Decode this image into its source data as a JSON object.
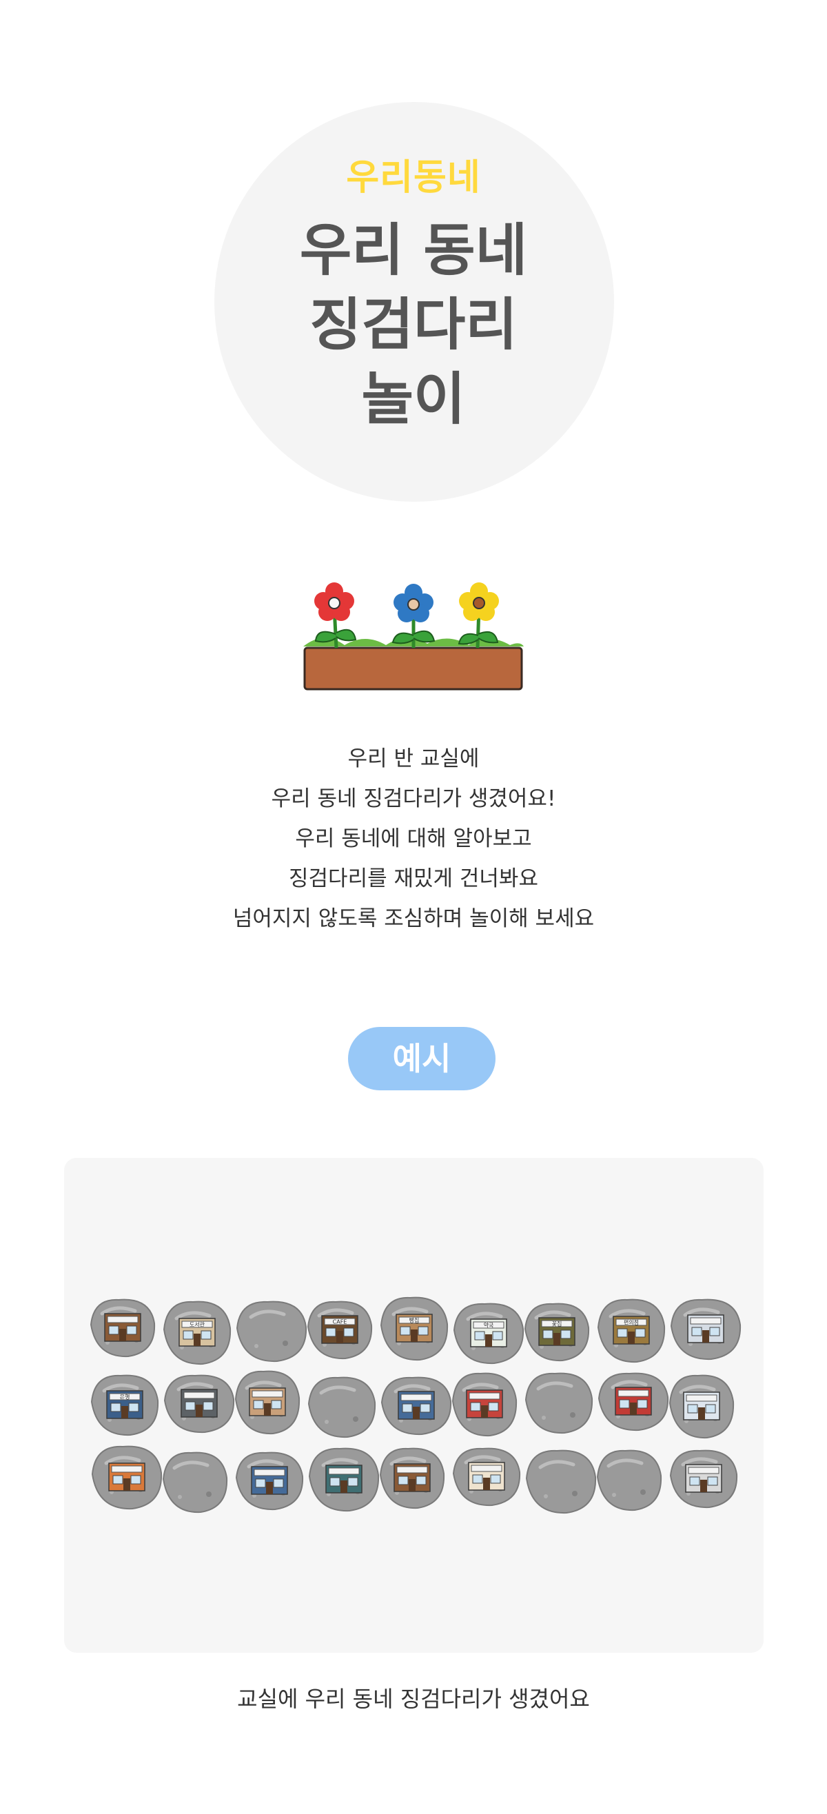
{
  "hero": {
    "tag": "우리동네",
    "title_lines": [
      "우리 동네",
      "징검다리",
      "놀이"
    ]
  },
  "intro_lines": [
    "우리 반 교실에",
    "우리 동네 징검다리가 생겼어요!",
    "우리 동네에 대해 알아보고",
    "징검다리를 재밌게 건너봐요",
    "넘어지지 않도록 조심하며 놀이해 보세요"
  ],
  "example": {
    "badge": "예시",
    "caption": "교실에 우리 동네 징검다리가 생겼어요",
    "stone_rows": [
      [
        {
          "sign": "",
          "building": "shop-brown"
        },
        {
          "sign": "도서관",
          "building": "library"
        },
        {
          "sign": "",
          "building": "blank"
        },
        {
          "sign": "CAFE",
          "building": "cafe"
        },
        {
          "sign": "빵집",
          "building": "bakery"
        },
        {
          "sign": "약국",
          "building": "pharmacy"
        },
        {
          "sign": "꽃집",
          "building": "florist"
        },
        {
          "sign": "편의점",
          "building": "store"
        },
        {
          "sign": "",
          "building": "office"
        }
      ],
      [
        {
          "sign": "은행",
          "building": "bank"
        },
        {
          "sign": "",
          "building": "shop-gray"
        },
        {
          "sign": "",
          "building": "shop-tan"
        },
        {
          "sign": "",
          "building": "blank"
        },
        {
          "sign": "",
          "building": "shop-blue"
        },
        {
          "sign": "",
          "building": "shop-red"
        },
        {
          "sign": "",
          "building": "blank"
        },
        {
          "sign": "",
          "building": "firestation"
        },
        {
          "sign": "",
          "building": "hospital"
        }
      ],
      [
        {
          "sign": "",
          "building": "shop-orange"
        },
        {
          "sign": "",
          "building": "blank"
        },
        {
          "sign": "",
          "building": "shop-blue"
        },
        {
          "sign": "",
          "building": "shop-teal"
        },
        {
          "sign": "",
          "building": "shop-brown"
        },
        {
          "sign": "",
          "building": "shop-cream"
        },
        {
          "sign": "",
          "building": "blank"
        },
        {
          "sign": "",
          "building": "blank"
        },
        {
          "sign": "",
          "building": "school"
        }
      ]
    ]
  },
  "colors": {
    "tag": "#ffd93d",
    "title": "#555555",
    "badge": "#98c8f7",
    "panel": "#f6f6f6",
    "hero_circle": "#f4f4f4"
  }
}
